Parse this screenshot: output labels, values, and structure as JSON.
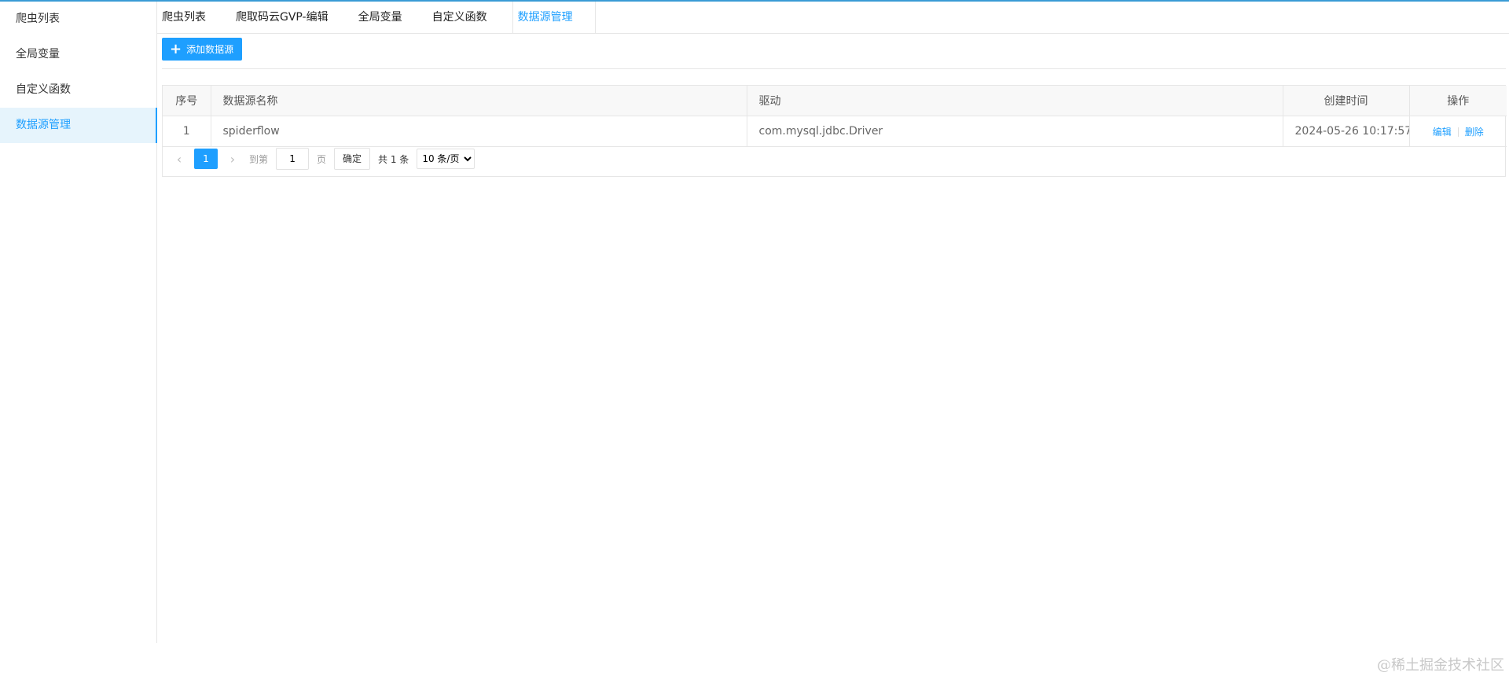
{
  "sidebar": {
    "items": [
      {
        "label": "爬虫列表"
      },
      {
        "label": "全局变量"
      },
      {
        "label": "自定义函数"
      },
      {
        "label": "数据源管理"
      }
    ]
  },
  "tabs": [
    {
      "label": "爬虫列表"
    },
    {
      "label": "爬取码云GVP-编辑"
    },
    {
      "label": "全局变量"
    },
    {
      "label": "自定义函数"
    },
    {
      "label": "数据源管理"
    }
  ],
  "toolbar": {
    "add_label": "添加数据源"
  },
  "table": {
    "headers": [
      "序号",
      "数据源名称",
      "驱动",
      "创建时间",
      "操作"
    ],
    "rows": [
      {
        "index": "1",
        "name": "spiderflow",
        "driver": "com.mysql.jdbc.Driver",
        "created": "2024-05-26 10:17:57",
        "edit": "编辑",
        "delete": "删除"
      }
    ]
  },
  "pager": {
    "current_page": "1",
    "goto_label": "到第",
    "page_input": "1",
    "page_unit": "页",
    "confirm_label": "确定",
    "total_label": "共 1 条",
    "page_size": "10 条/页"
  },
  "watermark": "@稀土掘金技术社区",
  "colors": {
    "accent": "#1e9fff",
    "active_bg": "#e6f4fc",
    "top_line": "#3a9bd5"
  }
}
